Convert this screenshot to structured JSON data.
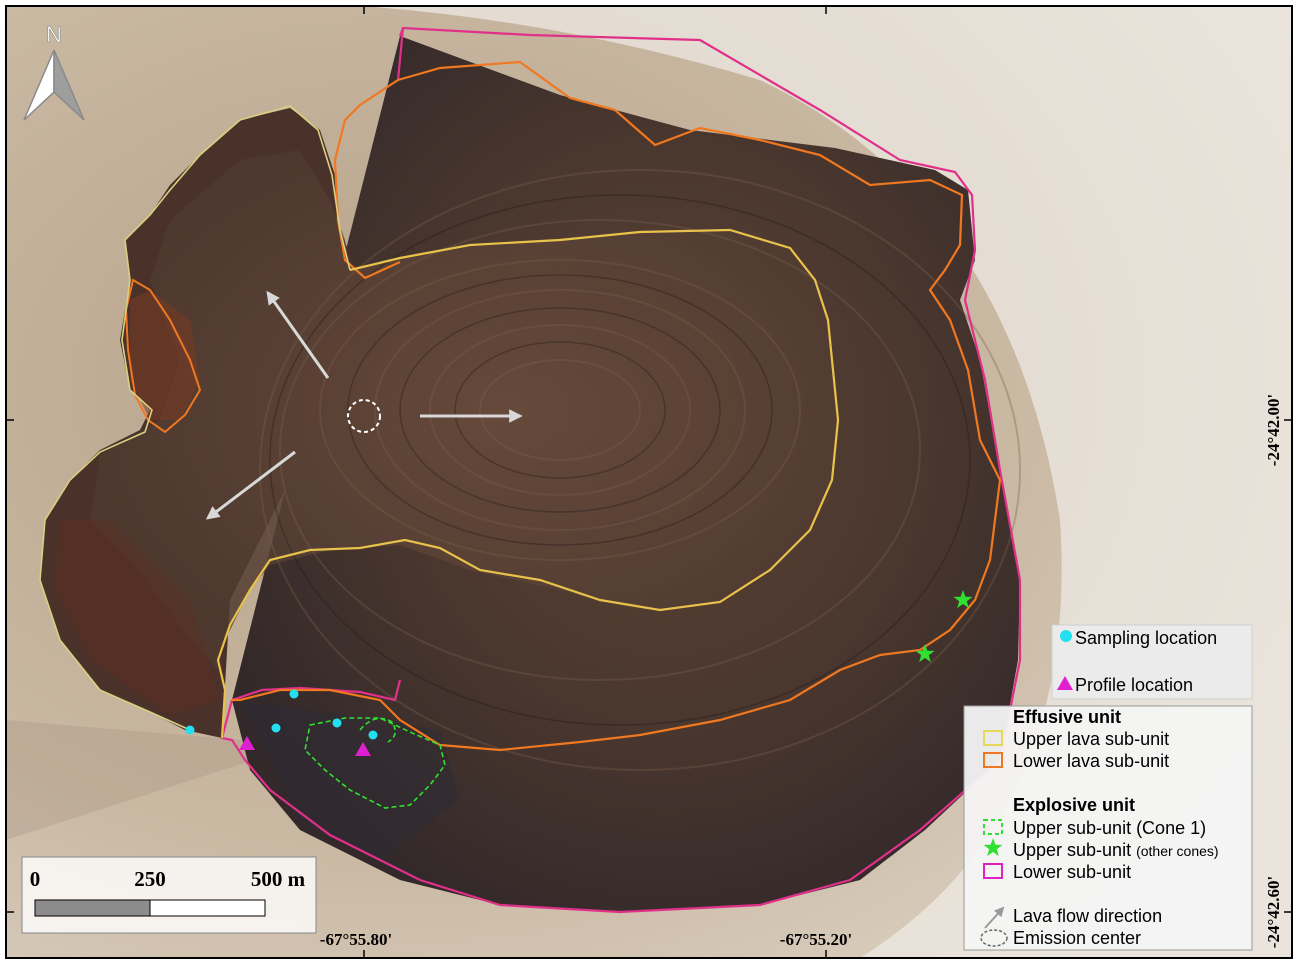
{
  "north_arrow": {
    "label": "N"
  },
  "scale_bar": {
    "ticks": [
      "0",
      "250",
      "500 m"
    ]
  },
  "coordinates": {
    "x_ticks": [
      "-67°55.80'",
      "-67°55.20'"
    ],
    "y_ticks": [
      "-24°42.00'",
      "-24°42.60'"
    ]
  },
  "legend_points": {
    "items": [
      {
        "label": "Sampling location",
        "symbol": "cyan-circle",
        "color": "#22e0f0"
      },
      {
        "label": "Profile location",
        "symbol": "magenta-triangle",
        "color": "#e020d0"
      }
    ]
  },
  "legend_units": {
    "effusive_title": "Effusive unit",
    "upper_lava": "Upper lava sub-unit",
    "lower_lava": "Lower lava sub-unit",
    "explosive_title": "Explosive unit",
    "upper_cone1": "Upper sub-unit (Cone 1)",
    "upper_other_main": "Upper sub-unit",
    "upper_other_suffix": "(other cones)",
    "lower_sub": "Lower sub-unit",
    "lava_flow": "Lava flow direction",
    "emission_center": "Emission center"
  },
  "colors": {
    "upper_lava": "#e8d85a",
    "lower_lava": "#f07820",
    "explosive_upper": "#30e030",
    "explosive_lower": "#e0308a",
    "sampling": "#22e0f0",
    "profile": "#e020d0",
    "flow_arrow": "#d8d8d8"
  }
}
